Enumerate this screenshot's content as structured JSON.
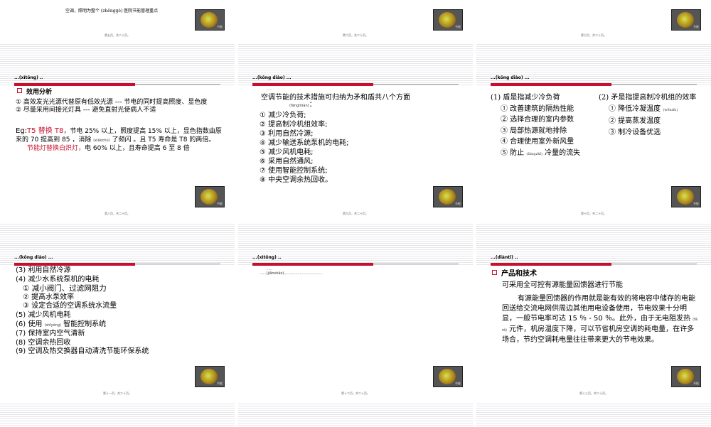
{
  "slides": {
    "s1": {
      "text": "空调，照明为整个 (zhěnggè) 医院节能管理重点",
      "page": "第五页，共二十页。"
    },
    "s2": {
      "page": "第六页，共二十页。"
    },
    "s3": {
      "page": "第七页，共二十页。"
    },
    "s4": {
      "header": "...(xìtǒng) ..",
      "title": "效用分析",
      "line1": "① 高效发光光源代替原有低效光源 --- 节电的同时提高照度、显色度",
      "line2": "② 尽量采用间接光灯具 --- 避免直射光使病人不适",
      "eg_prefix": "Eg:",
      "eg_red": "T5  替换 T8",
      "eg_rest": "，节电 25% 以上，照度提高 15% 以上，显色指数由原来的 70 提高到 85 ，消除 ",
      "eg_ruby": "(xiāochú)",
      "eg_tail": " 了频闪 。且 T5 寿命是 T8 的两倍。",
      "eg2_red": "节能灯替换白炽灯，",
      "eg2_rest": "电 60% 以上，且寿命提高 6 至 8 倍",
      "page": "第八页，共二十页。"
    },
    "s5": {
      "header": "...(kōng diào) ...",
      "small": "......",
      "intro": "空调节能的技术措施可归纳为矛和盾共八个方面",
      "intro_ruby": "(fāngmiàn)",
      "intro_end": "：",
      "items": [
        "① 减少冷负荷;",
        "② 提高制冷机组效率;",
        "③ 利用自然冷源;",
        "④ 减少输送系统泵机的电耗;",
        "⑤ 减少风机电耗;",
        "⑥ 采用自然通风;",
        "⑦ 使用智能控制系统;",
        "⑧ 中央空调余热回收。"
      ],
      "page": "第九页，共二十页。"
    },
    "s6": {
      "header": "...(kōng diào) ...",
      "left_title": "(1) 盾是指减少冷负荷",
      "left_items": [
        "① 改善建筑的隔热性能",
        "② 选择合理的室内参数",
        "③ 局部热源就地排除",
        "④ 合理使用室外新风量"
      ],
      "left_item5_a": "⑤ 防止 ",
      "left_item5_ruby": "(fángzhǐ)",
      "left_item5_b": " 冷量的流失",
      "right_title": "(2) 矛是指提高制冷机组的效率",
      "right_item1": "① 降低冷凝温度 ",
      "right_item1_ruby": "(wēndù)",
      "right_items": [
        "② 提高蒸发温度",
        "③ 制冷设备优选"
      ],
      "page": "第十页，共二十页。"
    },
    "s7": {
      "header": "...(kōng diào) ...",
      "items": [
        "(3) 利用自然冷源",
        "(4) 减少水系统泵机的电耗",
        "① 减小阀门、过滤网阻力",
        "② 提高水泵效率",
        "③ 设定合适的空调系统水流量",
        "(5) 减少风机电耗"
      ],
      "item6_a": "(6) 使用 ",
      "item6_ruby": "(shǐyòng)",
      "item6_b": " 智能控制系统",
      "items2": [
        "(7) 保持室内空气清新",
        "(8) 空调余热回收",
        "(9) 空调及热交换器自动清洗节能环保系统"
      ],
      "page": "第十一页，共二十页。"
    },
    "s8": {
      "header": "...(xìtǒng) ..",
      "small": "......",
      "line": "......(jiǎnshǎo)..................................",
      "page": "第十二页，共二十页。"
    },
    "s9": {
      "header": "...(diàntī) ..",
      "title": "产品和技术",
      "sub": "可采用全可控有源能量回馈器进行节能",
      "para_a": "有源能量回馈器的作用就是能有效的将电容中储存的电能回送给交流电网供周边其他用电设备使用，节电效果十分明显，一般节电率可达 15 ％ - 50 ％。此外，由于无电阻发热 ",
      "para_ruby": "(fā rè)",
      "para_b": " 元件，机房温度下降，可以节省机房空调的耗电量，在许多场合，节约空调耗电量往往带来更大的节电效果。",
      "page": "第十三页，共二十页。"
    },
    "logo_tag": "节能"
  },
  "colors": {
    "accent": "#c8102e",
    "line": "#e6e6ea"
  }
}
